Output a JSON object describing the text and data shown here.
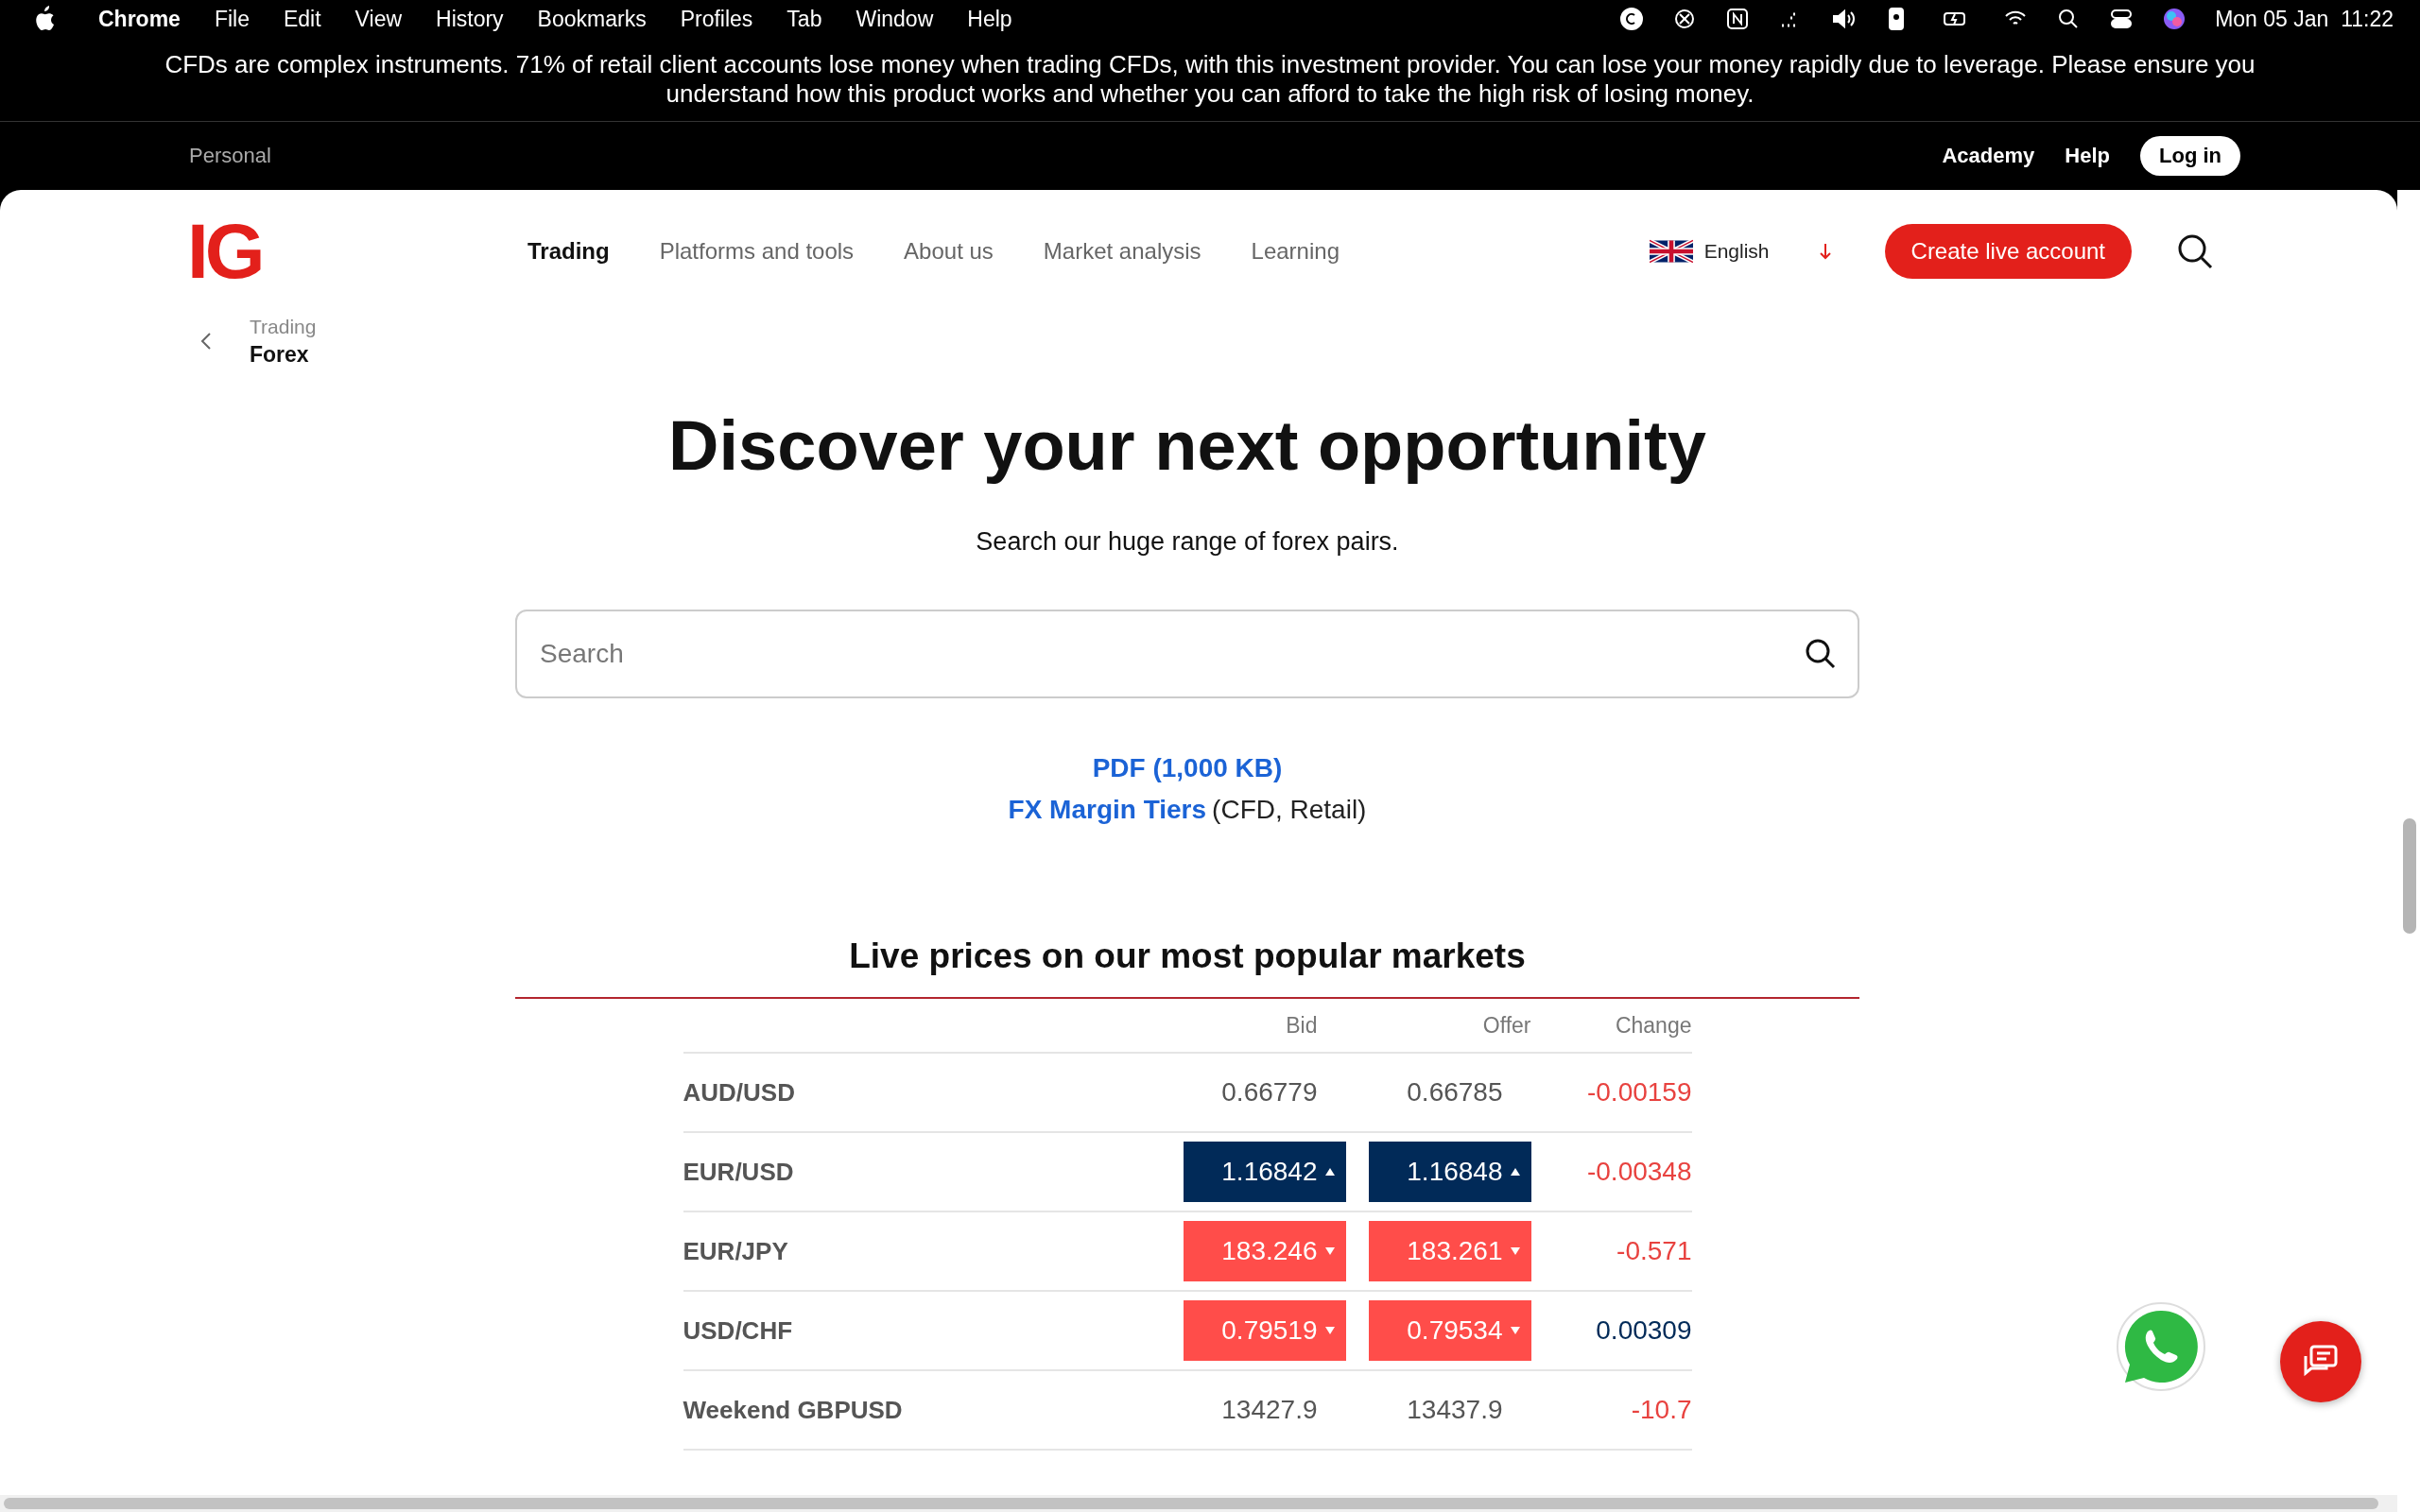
{
  "menu_bar": {
    "app": "Chrome",
    "items": [
      "File",
      "Edit",
      "View",
      "History",
      "Bookmarks",
      "Profiles",
      "Tab",
      "Window",
      "Help"
    ],
    "clock": "Mon 05 Jan  11:22"
  },
  "risk_warning": "CFDs are complex instruments. 71% of retail client accounts lose money when trading CFDs, with this investment provider. You can lose your money rapidly due to leverage. Please ensure you understand how this product works and whether you can afford to take the high risk of losing money.",
  "top_bar": {
    "segment": "Personal",
    "links": [
      "Academy",
      "Help"
    ],
    "login": "Log in"
  },
  "header": {
    "logo": "IG",
    "nav": [
      {
        "label": "Trading",
        "selected": true
      },
      {
        "label": "Platforms and tools",
        "selected": false
      },
      {
        "label": "About us",
        "selected": false
      },
      {
        "label": "Market analysis",
        "selected": false
      },
      {
        "label": "Learning",
        "selected": false
      }
    ],
    "language": "English",
    "cta": "Create live account"
  },
  "breadcrumb": {
    "parent": "Trading",
    "current": "Forex"
  },
  "hero": {
    "title": "Discover your next opportunity",
    "subtitle": "Search our huge range of forex pairs.",
    "search": {
      "placeholder": "Search"
    }
  },
  "documents": {
    "pdf_link": "PDF (1,000 KB)",
    "margin_link": "FX Margin Tiers",
    "margin_note": "(CFD, Retail)"
  },
  "prices": {
    "title": "Live prices on our most popular markets",
    "columns": [
      "Bid",
      "Offer",
      "Change"
    ],
    "rows": [
      {
        "market": "AUD/USD",
        "bid": "0.66779",
        "offer": "0.66785",
        "change": "-0.00159",
        "highlighted": false,
        "change_up": false
      },
      {
        "market": "EUR/USD",
        "bid": "1.16842",
        "offer": "1.16848",
        "change": "-0.00348",
        "highlighted": true,
        "tick_up": true,
        "change_up": false
      },
      {
        "market": "EUR/JPY",
        "bid": "183.246",
        "offer": "183.261",
        "change": "-0.571",
        "highlighted": true,
        "tick_up": false,
        "change_up": false
      },
      {
        "market": "USD/CHF",
        "bid": "0.79519",
        "offer": "0.79534",
        "change": "0.00309",
        "highlighted": true,
        "tick_up": false,
        "change_up": true
      },
      {
        "market": "Weekend GBPUSD",
        "bid": "13427.9",
        "offer": "13437.9",
        "change": "-10.7",
        "highlighted": false,
        "change_up": false
      }
    ]
  }
}
